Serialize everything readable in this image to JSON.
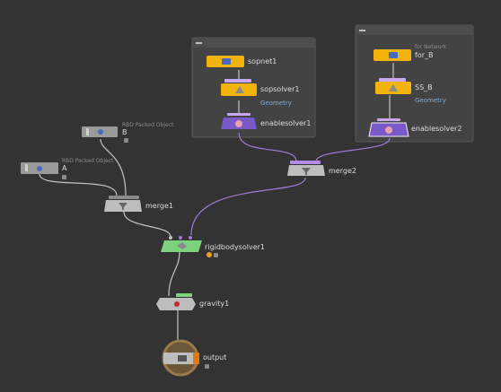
{
  "nodes": {
    "sopnet1": {
      "label": "sopnet1"
    },
    "sopsolver1": {
      "label": "sopsolver1",
      "sub": "Geometry"
    },
    "enablesolver1": {
      "label": "enablesolver1"
    },
    "for_b": {
      "label": "for_B"
    },
    "ss_b": {
      "label": "SS_B",
      "sub": "Geometry"
    },
    "enablesolver2": {
      "label": "enablesolver2"
    },
    "merge2": {
      "label": "merge2"
    },
    "b": {
      "label": "B",
      "comment": "RBD Packed Object"
    },
    "a": {
      "label": "A",
      "comment": "RBD Packed Object"
    },
    "merge1": {
      "label": "merge1"
    },
    "rigidbodysolver1": {
      "label": "rigidbodysolver1"
    },
    "gravity1": {
      "label": "gravity1"
    },
    "output": {
      "label": "output"
    }
  },
  "colors": {
    "background": "#333333",
    "wire_default": "#c2c2c2",
    "wire_purple": "#a07ad8",
    "node_yellow": "#f2b40c",
    "node_purple": "#7a5ac8",
    "node_green": "#7dd27d",
    "node_gray": "#b5b5b5",
    "output_ring": "#9a7a4a"
  }
}
